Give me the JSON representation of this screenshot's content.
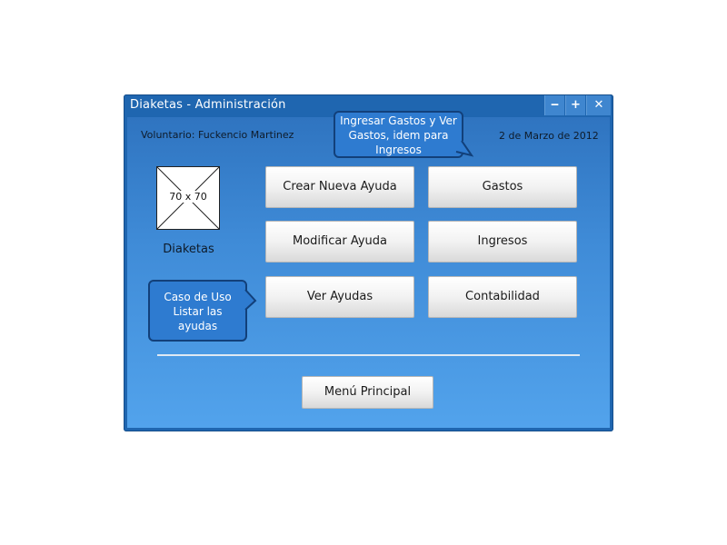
{
  "window": {
    "title": "Diaketas - Administración",
    "controls": {
      "minimize": "‒",
      "maximize": "+",
      "close": "✕"
    }
  },
  "header": {
    "volunteer": "Voluntario: Fuckencio Martinez",
    "date": "2 de Marzo de 2012"
  },
  "logo": {
    "placeholder_text": "70 x 70",
    "name": "Diaketas"
  },
  "buttons": {
    "crear": "Crear Nueva Ayuda",
    "gastos": "Gastos",
    "modificar": "Modificar Ayuda",
    "ingresos": "Ingresos",
    "ver": "Ver Ayudas",
    "contabilidad": "Contabilidad",
    "menu_principal": "Menú Principal"
  },
  "callouts": {
    "top_line1": "Ingresar Gastos y Ver",
    "top_line2": "Gastos, idem para",
    "top_line3": "Ingresos",
    "left_line1": "Caso de Uso",
    "left_line2": "Listar las",
    "left_line3": "ayudas"
  },
  "colors": {
    "window_frame": "#1f66b0",
    "client_top": "#2f74c0",
    "client_bottom": "#52a3ec",
    "callout_fill": "#2e7bd0",
    "callout_border": "#12407a"
  }
}
